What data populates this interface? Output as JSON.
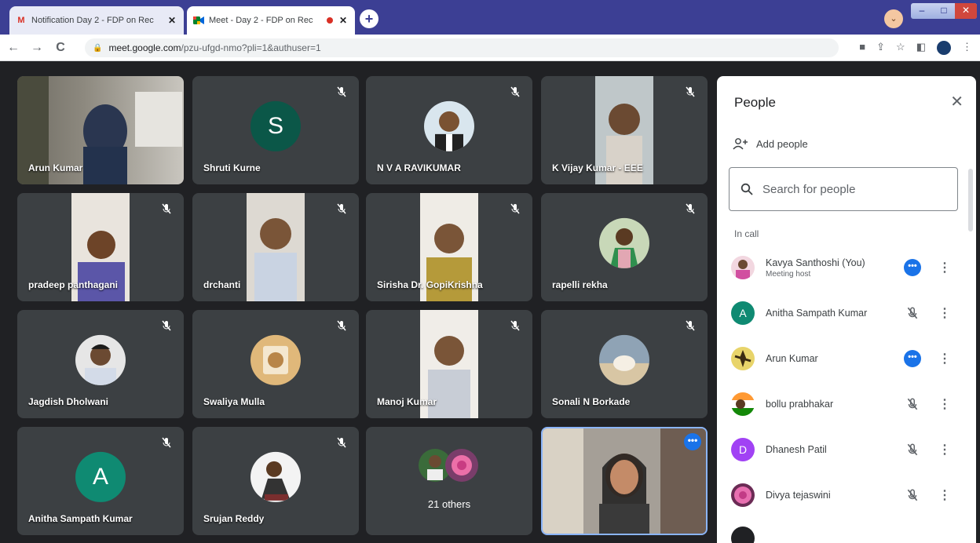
{
  "browser": {
    "tabs": [
      {
        "title": "Notification Day 2 - FDP on Rec",
        "favicon": "gmail-icon",
        "active": false
      },
      {
        "title": "Meet - Day 2 - FDP on Rec",
        "favicon": "meet-icon",
        "active": true
      }
    ],
    "close_glyph": "✕",
    "new_tab_glyph": "+",
    "url_host": "meet.google.com",
    "url_path": "/pzu-ufgd-nmo?pli=1&authuser=1",
    "nav": {
      "back": "←",
      "forward": "→",
      "reload": "C"
    }
  },
  "meet": {
    "tiles": [
      {
        "name": "Arun Kumar",
        "kind": "video"
      },
      {
        "name": "Shruti Kurne",
        "kind": "letter",
        "letter": "S",
        "color": "#0b5748",
        "muted": true
      },
      {
        "name": "N V A RAVIKUMAR",
        "kind": "photo",
        "muted": true
      },
      {
        "name": "K Vijay Kumar - EEE",
        "kind": "video",
        "muted": true
      },
      {
        "name": "pradeep panthagani",
        "kind": "video",
        "muted": true
      },
      {
        "name": "drchanti",
        "kind": "video",
        "muted": true
      },
      {
        "name": "Sirisha Dr. GopiKrishna",
        "kind": "video",
        "muted": true
      },
      {
        "name": "rapelli rekha",
        "kind": "photo",
        "muted": true
      },
      {
        "name": "Jagdish Dholwani",
        "kind": "photo",
        "muted": true
      },
      {
        "name": "Swaliya Mulla",
        "kind": "photo",
        "muted": true
      },
      {
        "name": "Manoj Kumar",
        "kind": "video",
        "muted": true
      },
      {
        "name": "Sonali N Borkade",
        "kind": "photo",
        "muted": true
      },
      {
        "name": "Anitha Sampath Kumar",
        "kind": "letter",
        "letter": "A",
        "color": "#0f8a72",
        "muted": true
      },
      {
        "name": "Srujan Reddy",
        "kind": "photo",
        "muted": true
      },
      {
        "name": "21 others",
        "kind": "others"
      },
      {
        "name": "",
        "kind": "self",
        "more": "•••"
      }
    ]
  },
  "people_panel": {
    "title": "People",
    "close_glyph": "✕",
    "add_people_label": "Add people",
    "search_placeholder": "Search for people",
    "section_label": "In call",
    "participants": [
      {
        "name": "Kavya Santhoshi (You)",
        "subtitle": "Meeting host",
        "status": "more",
        "avatar": "photo"
      },
      {
        "name": "Anitha Sampath Kumar",
        "subtitle": "",
        "status": "muted",
        "avatar": "letter",
        "letter": "A",
        "color": "#0f8a72"
      },
      {
        "name": "Arun Kumar",
        "subtitle": "",
        "status": "more",
        "avatar": "photo"
      },
      {
        "name": "bollu prabhakar",
        "subtitle": "",
        "status": "muted",
        "avatar": "photo"
      },
      {
        "name": "Dhanesh Patil",
        "subtitle": "",
        "status": "muted",
        "avatar": "letter",
        "letter": "D",
        "color": "#a142f4"
      },
      {
        "name": "Divya tejaswini",
        "subtitle": "",
        "status": "muted",
        "avatar": "photo"
      }
    ],
    "more_glyph": "⋮",
    "dots_glyph": "•••"
  }
}
